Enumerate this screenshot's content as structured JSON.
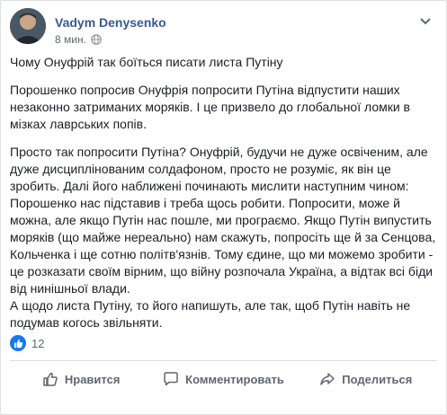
{
  "post": {
    "author": "Vadym Denysenko",
    "timestamp": "8 мин.",
    "privacy_icon": "globe-icon",
    "paragraphs": [
      "Чому Онуфрій так боїться писати листа Путіну",
      "Порошенко попросив Онуфрія попросити Путіна відпустити наших незаконно затриманих моряків. І це призвело до глобальної ломки в мізках лаврських попів.",
      "Просто так попросити Путіна? Онуфрій, будучи не дуже освіченим, але дуже дисциплінованим солдафоном, просто не розуміє, як він це зробить. Далі його наближені починають мислити наступним чином:\nПорошенко нас підставив і треба щось робити. Попросити, може й можна, але якщо Путін нас пошле, ми програємо. Якщо Путін випустить моряків (що майже нереально) нам скажуть, попросіть ще й за Сенцова, Кольченка і ще сотню політв'язнів. Тому єдине, що ми можемо зробити - це розказати своїм вірним, що війну розпочала Україна, а відтак всі біди від нинішньої влади.\nА щодо листа Путіну, то його напишуть, але так, щоб Путін навіть не подумав когось звільняти."
    ]
  },
  "reactions": {
    "count": "12",
    "icon": "like-icon"
  },
  "actions": {
    "like_label": "Нравится",
    "comment_label": "Комментировать",
    "share_label": "Поделиться"
  },
  "colors": {
    "link": "#385898",
    "accent": "#1877f2",
    "muted": "#606770"
  }
}
